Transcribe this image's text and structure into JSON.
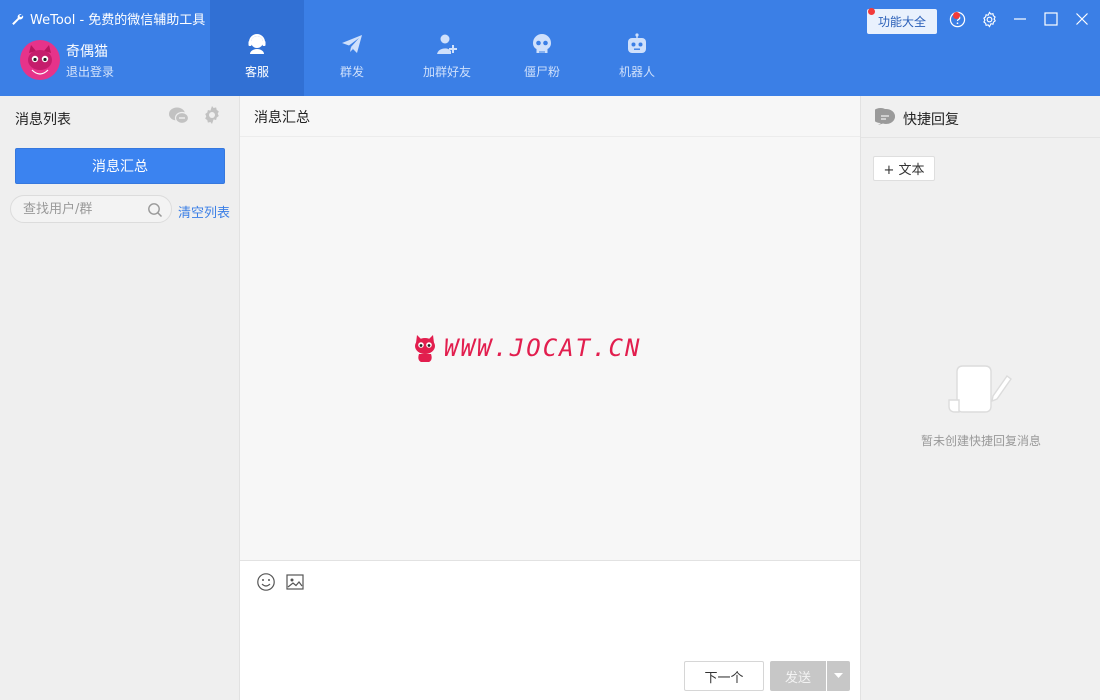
{
  "app": {
    "title": "WeTool - 免费的微信辅助工具"
  },
  "user": {
    "name": "奇偶猫",
    "logout_label": "退出登录"
  },
  "nav": {
    "tabs": [
      {
        "label": "客服",
        "icon": "customer-service-icon",
        "active": true
      },
      {
        "label": "群发",
        "icon": "paper-plane-icon",
        "active": false
      },
      {
        "label": "加群好友",
        "icon": "add-friend-icon",
        "active": false
      },
      {
        "label": "僵尸粉",
        "icon": "skull-icon",
        "active": false
      },
      {
        "label": "机器人",
        "icon": "robot-icon",
        "active": false
      }
    ]
  },
  "toolbar": {
    "features_label": "功能大全"
  },
  "sidebar": {
    "title": "消息列表",
    "summary_button": "消息汇总",
    "search_placeholder": "查找用户/群",
    "clear_link": "清空列表"
  },
  "main": {
    "title": "消息汇总",
    "watermark": "WWW.JOCAT.CN",
    "next_label": "下一个",
    "send_label": "发送"
  },
  "quick_reply": {
    "title": "快捷回复",
    "add_text_label": "+ 文本",
    "empty_message": "暂未创建快捷回复消息"
  },
  "colors": {
    "header": "#3b7fe6",
    "active_tab": "#3170d4",
    "primary_button": "#3b83f0",
    "watermark": "#e21e4e"
  }
}
